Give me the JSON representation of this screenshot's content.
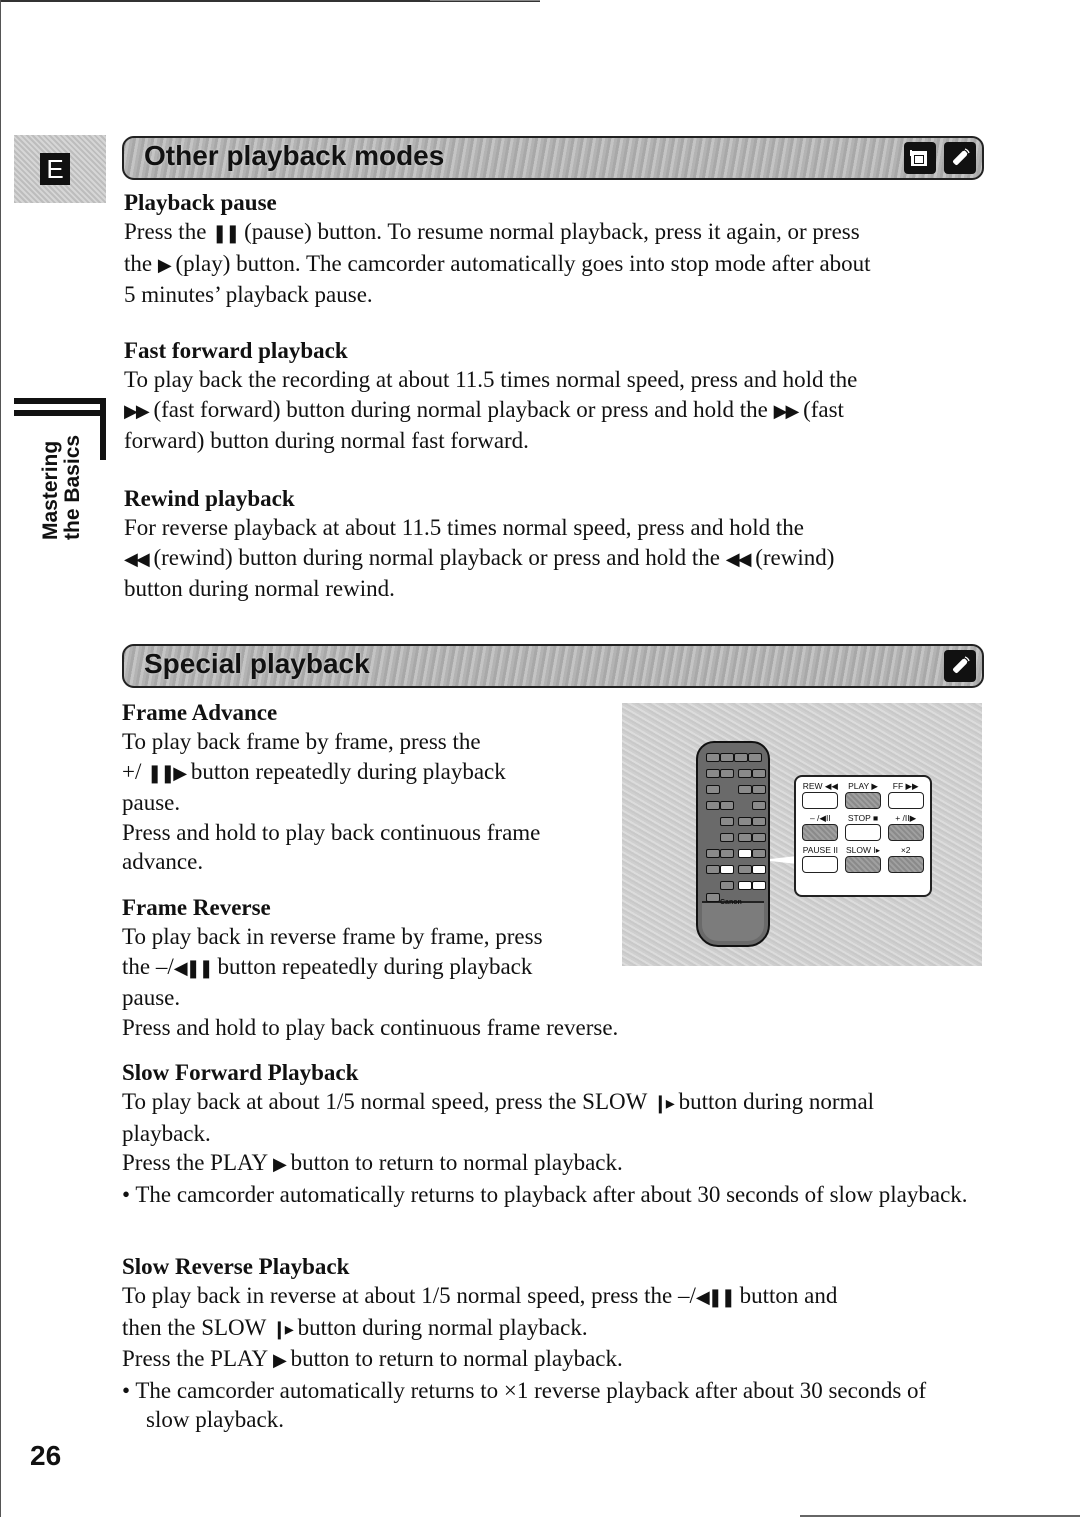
{
  "side_tab": {
    "letter": "E",
    "label_line1": "Mastering",
    "label_line2": "the Basics"
  },
  "sections": {
    "other": {
      "title": "Other playback modes",
      "icons": [
        "camcorder-icon",
        "remote-control-icon"
      ],
      "pause": {
        "heading": "Playback pause",
        "l1a": "Press the ",
        "l1sym": "❚❚",
        "l1b": " (pause) button. To resume normal playback, press it again, or press",
        "l2a": "the ",
        "l2sym": "▶",
        "l2b": " (play) button. The camcorder automatically goes into stop mode after about",
        "l3": "5 minutes’ playback pause."
      },
      "ff": {
        "heading": "Fast forward playback",
        "l1": "To play back the recording at about 11.5 times normal speed, press and hold the",
        "l2sym": "▶▶",
        "l2a": " (fast forward) button during normal playback or press and hold the ",
        "l2sym2": "▶▶",
        "l2b": " (fast",
        "l3": "forward) button during normal fast forward."
      },
      "rew": {
        "heading": "Rewind playback",
        "l1": "For reverse playback at about 11.5 times normal speed, press and hold the",
        "l2sym": "◀◀",
        "l2a": " (rewind) button during normal playback or press and hold the ",
        "l2sym2": "◀◀",
        "l2b": " (rewind)",
        "l3": "button during normal rewind."
      }
    },
    "special": {
      "title": "Special playback",
      "icons": [
        "remote-control-icon"
      ],
      "advance": {
        "heading": "Frame Advance",
        "l1": "To play back frame by frame, press the",
        "l2a": "+/ ",
        "l2sym": "❚❚▶",
        "l2b": " button repeatedly during playback",
        "l3": "pause.",
        "l4": "Press and hold to play back continuous frame",
        "l5": "advance."
      },
      "reverse": {
        "heading": "Frame Reverse",
        "l1": "To play back in reverse frame by frame, press",
        "l2a": "the –/",
        "l2sym": "◀❚❚",
        "l2b": " button repeatedly during playback",
        "l3": "pause.",
        "l4": "Press and hold to play back continuous frame reverse."
      },
      "slow_fwd": {
        "heading": "Slow Forward Playback",
        "l1a": "To play back at about 1/5 normal speed, press the SLOW ",
        "l1sym": "❙▸",
        "l1b": " button during normal",
        "l2": "playback.",
        "l3a": "Press the PLAY ",
        "l3sym": "▶",
        "l3b": " button to return to normal playback.",
        "bullet": "• The camcorder automatically returns to playback after about 30 seconds of slow playback."
      },
      "slow_rev": {
        "heading": "Slow Reverse Playback",
        "l1a": "To play back in reverse at about 1/5 normal speed, press the –/",
        "l1sym": "◀❚❚",
        "l1b": " button and",
        "l2a": "then the SLOW ",
        "l2sym": "❙▸",
        "l2b": " button during normal playback.",
        "l3a": "Press the PLAY ",
        "l3sym": "▶",
        "l3b": " button to return to normal playback.",
        "bullet": "• The camcorder automatically returns to ×1 reverse playback after about 30 seconds of slow playback."
      }
    }
  },
  "remote_figure": {
    "brand": "Canon",
    "buttons": [
      {
        "label": "REW ◀◀",
        "style": "light"
      },
      {
        "label": "PLAY ▶",
        "style": "dark"
      },
      {
        "label": "FF ▶▶",
        "style": "light"
      },
      {
        "label": "– /◀II",
        "style": "dark"
      },
      {
        "label": "STOP ■",
        "style": "light"
      },
      {
        "label": "+ /II▶",
        "style": "dark"
      },
      {
        "label": "PAUSE II",
        "style": "light"
      },
      {
        "label": "SLOW I▸",
        "style": "dark"
      },
      {
        "label": "×2",
        "style": "dark"
      }
    ]
  },
  "page_number": "26"
}
